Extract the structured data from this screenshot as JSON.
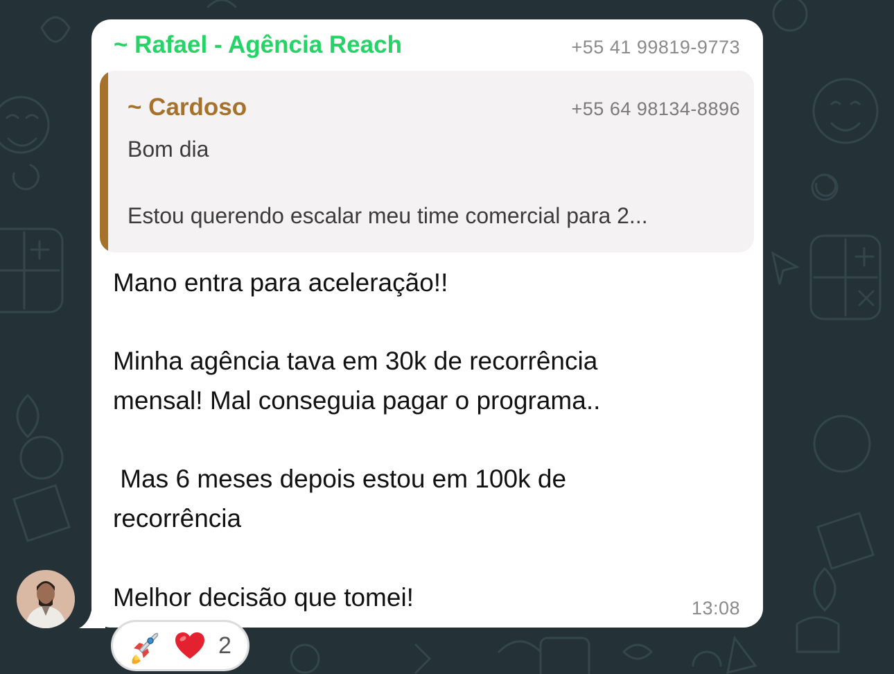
{
  "message": {
    "sender_name": "~ Rafael - Agência Reach",
    "sender_phone": "+55 41 99819-9773",
    "quoted": {
      "sender_name": "~ Cardoso",
      "sender_phone": "+55 64 98134-8896",
      "line1": "Bom dia",
      "line2": "Estou querendo escalar meu time comercial para 2..."
    },
    "body": {
      "p1": "Mano entra para aceleração!!",
      "p2a": "Minha agência tava em 30k de recorrência",
      "p2b": "mensal! Mal conseguia pagar o programa..",
      "p3a": " Mas 6 meses depois estou em 100k de",
      "p3b": "recorrência",
      "p4": "Melhor decisão que tomei!"
    },
    "time": "13:08",
    "reactions": {
      "emojis": [
        "rocket-icon",
        "heart-icon"
      ],
      "count": "2"
    }
  },
  "colors": {
    "chat_background": "#243238",
    "sender_name": "#25d366",
    "quote_accent": "#a5712b",
    "bubble": "#ffffff"
  }
}
